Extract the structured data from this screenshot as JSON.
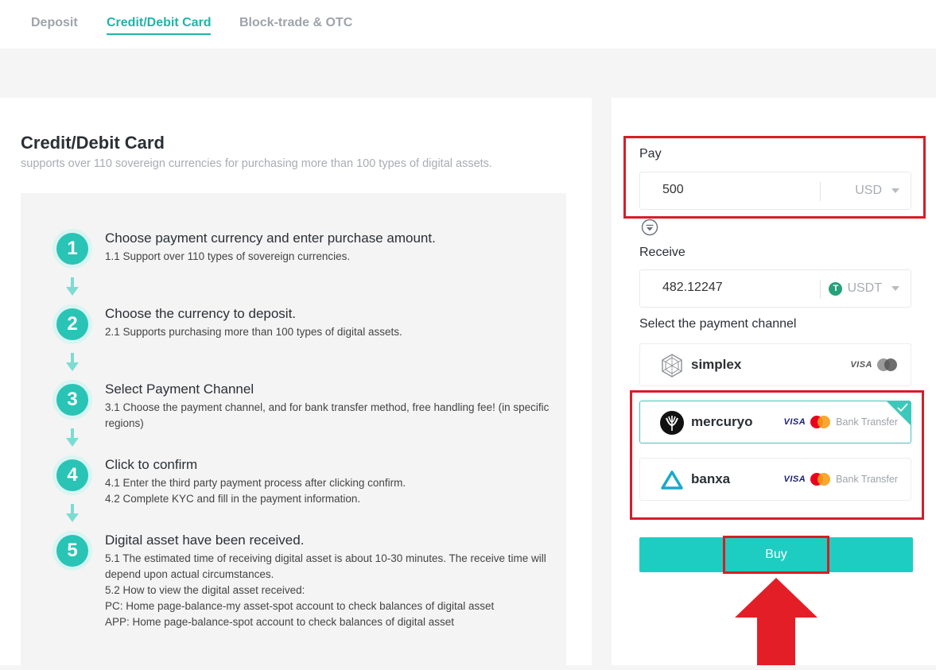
{
  "tabs": [
    {
      "label": "Deposit",
      "active": false
    },
    {
      "label": "Credit/Debit Card",
      "active": true
    },
    {
      "label": "Block-trade & OTC",
      "active": false
    }
  ],
  "info": {
    "title": "Credit/Debit Card",
    "subtitle": "supports over 110 sovereign currencies for purchasing more than 100 types of digital assets.",
    "steps": [
      {
        "number": "1",
        "title": "Choose payment currency and enter purchase amount.",
        "details": [
          "1.1 Support over 110 types of sovereign currencies."
        ]
      },
      {
        "number": "2",
        "title": "Choose the currency to deposit.",
        "details": [
          "2.1 Supports purchasing more than 100 types of digital assets."
        ]
      },
      {
        "number": "3",
        "title": "Select Payment Channel",
        "details": [
          "3.1 Choose the payment channel, and for bank transfer method, free handling fee! (in specific regions)"
        ]
      },
      {
        "number": "4",
        "title": "Click to confirm",
        "details": [
          "4.1 Enter the third party payment process after clicking confirm.",
          "4.2 Complete KYC and fill in the payment information."
        ]
      },
      {
        "number": "5",
        "title": "Digital asset have been received.",
        "details": [
          "5.1 The estimated time of receiving digital asset is about 10-30 minutes. The receive time will depend upon actual circumstances.",
          "5.2 How to view the digital asset received:",
          "PC: Home page-balance-my asset-spot account to check balances of digital asset",
          "APP: Home page-balance-spot account to check balances of digital asset"
        ]
      }
    ]
  },
  "form": {
    "pay_label": "Pay",
    "pay_value": "500",
    "pay_currency": "USD",
    "receive_label": "Receive",
    "receive_value": "482.12247",
    "receive_currency": "USDT",
    "receive_currency_icon": "T",
    "channel_label": "Select the payment channel",
    "channels": [
      {
        "name": "simplex",
        "visa": "VISA",
        "bank": "",
        "selected": false
      },
      {
        "name": "mercuryo",
        "visa": "VISA",
        "bank": "Bank Transfer",
        "selected": true
      },
      {
        "name": "banxa",
        "visa": "VISA",
        "bank": "Bank Transfer",
        "selected": false
      }
    ],
    "buy_label": "Buy"
  },
  "colors": {
    "accent": "#1fb5a8",
    "button": "#1ecdc2",
    "highlight": "#d71d27",
    "usdt": "#26a17b"
  }
}
